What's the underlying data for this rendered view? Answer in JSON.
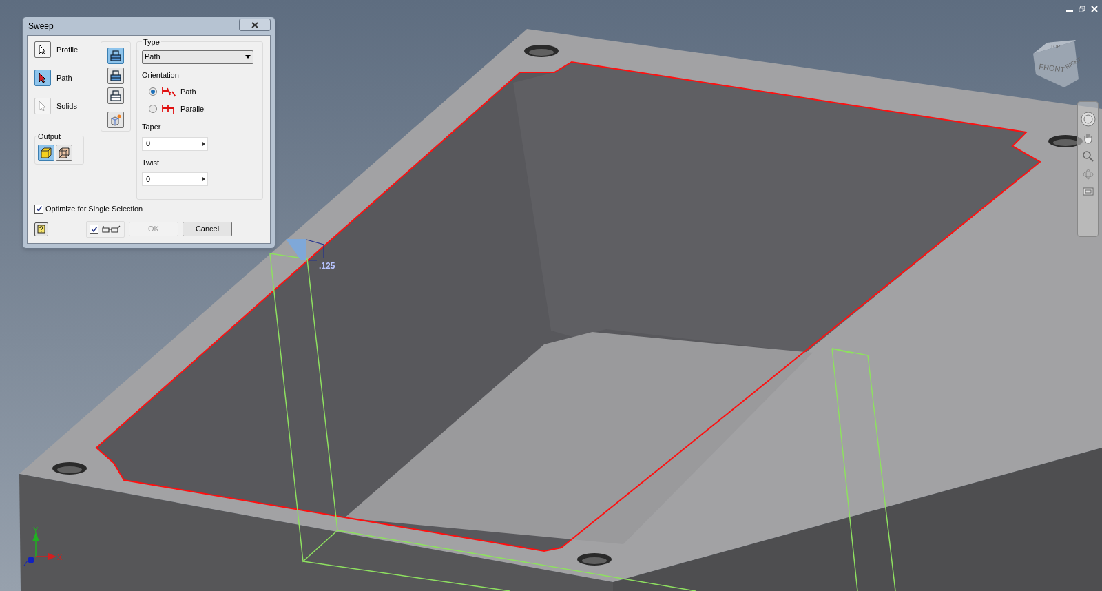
{
  "dialog": {
    "title": "Sweep",
    "selectors": [
      {
        "label": "Profile",
        "selected": false,
        "disabled": false
      },
      {
        "label": "Path",
        "selected": true,
        "disabled": false
      },
      {
        "label": "Solids",
        "selected": false,
        "disabled": true
      }
    ],
    "tools": [
      {
        "kind": "profile-plane",
        "selected": true
      },
      {
        "kind": "profile-plane",
        "selected": false
      },
      {
        "kind": "profile-plane",
        "selected": false
      },
      {
        "kind": "new-solid",
        "selected": false
      }
    ],
    "output": {
      "label": "Output",
      "options": [
        {
          "kind": "solid",
          "selected": true
        },
        {
          "kind": "surface",
          "selected": false
        }
      ]
    },
    "type": {
      "label": "Type",
      "value": "Path"
    },
    "orientation": {
      "label": "Orientation",
      "options": [
        {
          "label": "Path",
          "selected": true
        },
        {
          "label": "Parallel",
          "selected": false
        }
      ]
    },
    "taper": {
      "label": "Taper",
      "value": "0"
    },
    "twist": {
      "label": "Twist",
      "value": "0"
    },
    "optimize": {
      "label": "Optimize for Single Selection",
      "checked": true
    },
    "preview": {
      "checked": true
    },
    "buttons": [
      {
        "label": "OK",
        "disabled": true
      },
      {
        "label": "Cancel",
        "disabled": false
      }
    ]
  },
  "view_cube": {
    "top": "TOP",
    "front": "FRONT",
    "right": "RIGHT"
  },
  "axes": {
    "x": "X",
    "y": "Y",
    "z": "Z"
  },
  "dimension": {
    "value": ".125"
  }
}
